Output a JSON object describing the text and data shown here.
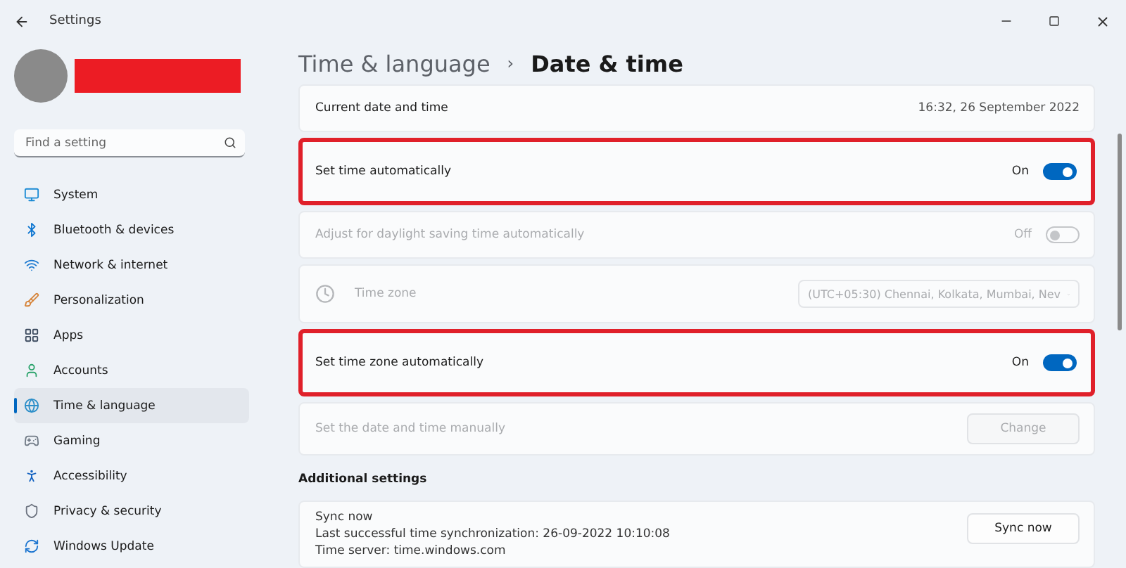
{
  "window": {
    "title": "Settings"
  },
  "search": {
    "placeholder": "Find a setting"
  },
  "sidebar": {
    "items": [
      {
        "label": "System",
        "selected": false
      },
      {
        "label": "Bluetooth & devices",
        "selected": false
      },
      {
        "label": "Network & internet",
        "selected": false
      },
      {
        "label": "Personalization",
        "selected": false
      },
      {
        "label": "Apps",
        "selected": false
      },
      {
        "label": "Accounts",
        "selected": false
      },
      {
        "label": "Time & language",
        "selected": true
      },
      {
        "label": "Gaming",
        "selected": false
      },
      {
        "label": "Accessibility",
        "selected": false
      },
      {
        "label": "Privacy & security",
        "selected": false
      },
      {
        "label": "Windows Update",
        "selected": false
      }
    ]
  },
  "breadcrumb": {
    "parent": "Time & language",
    "separator": "›",
    "current": "Date & time"
  },
  "rows": [
    {
      "kind": "info",
      "label": "Current date and time",
      "value": "16:32, 26 September 2022",
      "highlighted": false
    },
    {
      "kind": "toggle",
      "label": "Set time automatically",
      "state": "On",
      "on": true,
      "disabled": false,
      "highlighted": true
    },
    {
      "kind": "toggle",
      "label": "Adjust for daylight saving time automatically",
      "state": "Off",
      "on": false,
      "disabled": true,
      "highlighted": false
    },
    {
      "kind": "select",
      "label": "Time zone",
      "value": "(UTC+05:30) Chennai, Kolkata, Mumbai, Nev",
      "disabled": true,
      "highlighted": false
    },
    {
      "kind": "toggle",
      "label": "Set time zone automatically",
      "state": "On",
      "on": true,
      "disabled": false,
      "highlighted": true
    },
    {
      "kind": "button",
      "label": "Set the date and time manually",
      "button": "Change",
      "disabled": true,
      "highlighted": false
    }
  ],
  "additional": {
    "title": "Additional settings",
    "sync": {
      "title": "Sync now",
      "lines": [
        "Last successful time synchronization: 26-09-2022 10:10:08",
        "Time server: time.windows.com"
      ],
      "button": "Sync now"
    }
  }
}
